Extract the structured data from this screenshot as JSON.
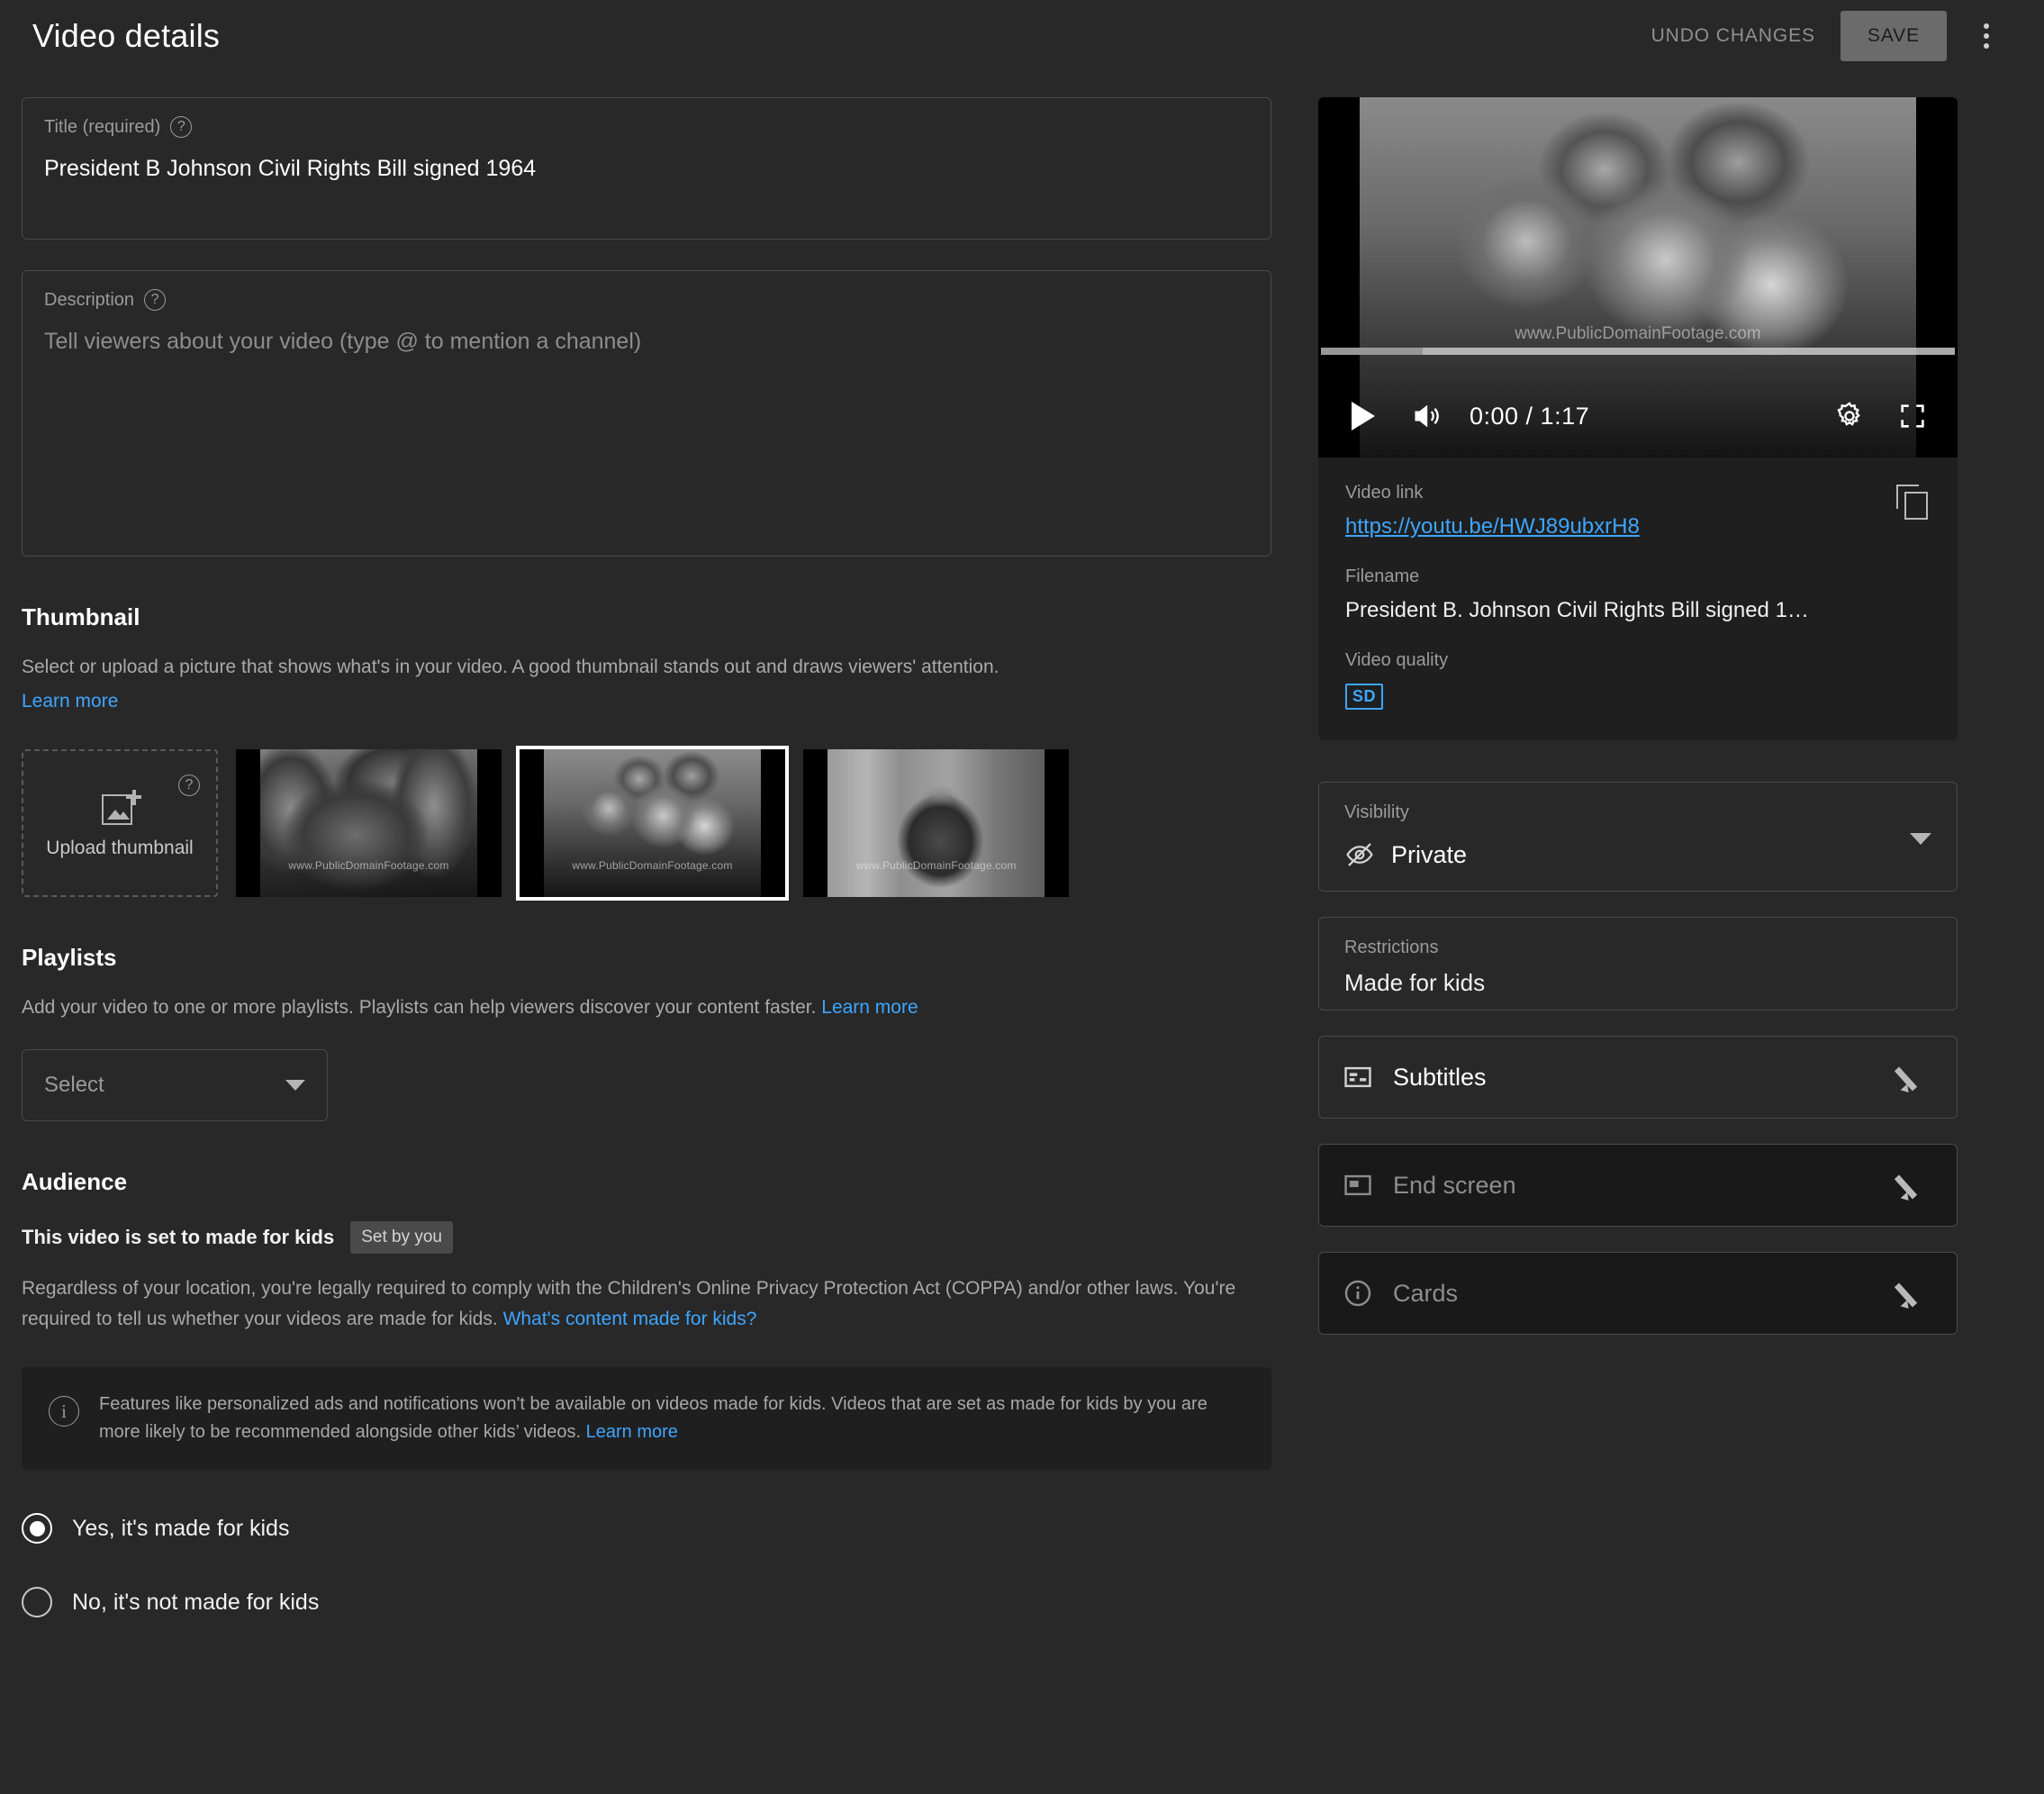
{
  "header": {
    "title": "Video details",
    "undo_label": "UNDO CHANGES",
    "save_label": "SAVE",
    "more_options_icon": "kebab-menu-icon"
  },
  "title_field": {
    "label": "Title (required)",
    "help_icon": "help-circle-icon",
    "value": "President B  Johnson Civil Rights Bill signed 1964"
  },
  "description_field": {
    "label": "Description",
    "help_icon": "help-circle-icon",
    "placeholder": "Tell viewers about your video (type @ to mention a channel)",
    "value": ""
  },
  "thumbnail": {
    "heading": "Thumbnail",
    "description": "Select or upload a picture that shows what's in your video. A good thumbnail stands out and draws viewers' attention.",
    "learn_more": "Learn more",
    "upload_label": "Upload thumbnail",
    "upload_icon": "add-photo-icon",
    "help_icon": "help-circle-icon",
    "watermark": "www.PublicDomainFootage.com",
    "options": [
      {
        "alt": "LBJ signing Civil Rights Bill at desk with onlookers",
        "selected": false
      },
      {
        "alt": "Martin Luther King Jr. in crowd at signing ceremony",
        "selected": true
      },
      {
        "alt": "President Johnson seated at desk in White House",
        "selected": false
      }
    ]
  },
  "playlists": {
    "heading": "Playlists",
    "description": "Add your video to one or more playlists. Playlists can help viewers discover your content faster.",
    "learn_more": "Learn more",
    "select_placeholder": "Select",
    "caret_icon": "chevron-down-icon"
  },
  "audience": {
    "heading": "Audience",
    "status_text": "This video is set to made for kids",
    "badge": "Set by you",
    "coppa_text": "Regardless of your location, you're legally required to comply with the Children's Online Privacy Protection Act (COPPA) and/or other laws. You're required to tell us whether your videos are made for kids.",
    "coppa_link": "What's content made for kids?",
    "info_icon": "info-circle-icon",
    "info_text": "Features like personalized ads and notifications won't be available on videos made for kids. Videos that are set as made for kids by you are more likely to be recommended alongside other kids’ videos.",
    "info_link": "Learn more",
    "options": [
      {
        "label": "Yes, it's made for kids",
        "selected": true
      },
      {
        "label": "No, it's not made for kids",
        "selected": false
      }
    ]
  },
  "player": {
    "play_icon": "play-icon",
    "volume_icon": "volume-icon",
    "time": "0:00 / 1:17",
    "current_time": "0:00",
    "duration": "1:17",
    "settings_icon": "gear-icon",
    "fullscreen_icon": "fullscreen-icon",
    "watermark": "www.PublicDomainFootage.com",
    "frame_alt": "Martin Luther King Jr. among officials at Civil Rights Act signing"
  },
  "video_meta": {
    "link_label": "Video link",
    "link_value": "https://youtu.be/HWJ89ubxrH8",
    "copy_icon": "copy-icon",
    "filename_label": "Filename",
    "filename_value": "President B. Johnson Civil Rights Bill signed 1…",
    "quality_label": "Video quality",
    "quality_badge": "SD"
  },
  "visibility": {
    "label": "Visibility",
    "value": "Private",
    "icon": "eye-off-icon",
    "caret_icon": "chevron-down-icon"
  },
  "restrictions": {
    "label": "Restrictions",
    "value": "Made for kids"
  },
  "feature_rows": [
    {
      "label": "Subtitles",
      "icon": "subtitles-icon",
      "edit_icon": "pencil-icon",
      "disabled": false
    },
    {
      "label": "End screen",
      "icon": "end-screen-icon",
      "edit_icon": "pencil-icon",
      "disabled": true
    },
    {
      "label": "Cards",
      "icon": "info-circle-icon",
      "edit_icon": "pencil-icon",
      "disabled": true
    }
  ],
  "colors": {
    "page_bg": "#282828",
    "card_bg": "#1f1f1f",
    "disabled_card_bg": "#191919",
    "accent_link": "#3ea6ff",
    "border": "#4a4a4a",
    "save_bg": "#6b6b6b"
  }
}
